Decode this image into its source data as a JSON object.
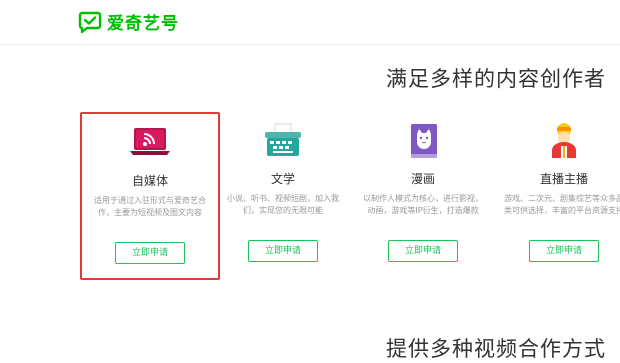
{
  "brand": {
    "name": "爱奇艺号",
    "color": "#00be06"
  },
  "section1": {
    "title": "满足多样的内容创作者"
  },
  "section2": {
    "title": "提供多种视频合作方式"
  },
  "cards": [
    {
      "title": "自媒体",
      "description": "适用于通过入驻形式与爱奇艺合作，主要为短视频及图文内容",
      "button": "立即申请",
      "icon": "laptop-rss-icon",
      "selected": true
    },
    {
      "title": "文学",
      "description": "小说、听书、视频短剧，加入我们，实现您的无限可能",
      "button": "立即申请",
      "icon": "typewriter-icon",
      "selected": false
    },
    {
      "title": "漫画",
      "description": "以制作人模式为核心，进行影视，动画，游戏等IP衍生，打造爆款",
      "button": "立即申请",
      "icon": "cat-book-icon",
      "selected": false
    },
    {
      "title": "直播主播",
      "description": "游戏、二次元、剧集综艺等众多品类可供选择，丰富的平台资源支持",
      "button": "立即申请",
      "icon": "streamer-avatar-icon",
      "selected": false
    }
  ],
  "colors": {
    "accent": "#19c35a",
    "selection_border": "#e53935"
  }
}
